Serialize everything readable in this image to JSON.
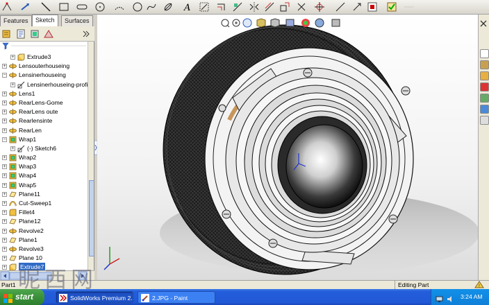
{
  "tabs": [
    {
      "label": "Features",
      "active": false
    },
    {
      "label": "Sketch",
      "active": true
    },
    {
      "label": "Surfaces",
      "active": false
    }
  ],
  "tree": {
    "items": [
      {
        "label": "Extrude3",
        "icon": "extrude-icon",
        "indent": 1
      },
      {
        "label": "Lensouterhouseing",
        "icon": "revolve-icon",
        "indent": 0
      },
      {
        "label": "Lensinerhouseing",
        "icon": "revolve-icon",
        "indent": 0,
        "expanded": true
      },
      {
        "label": "Lensinerhouseing-profil",
        "icon": "sketch-icon",
        "indent": 1
      },
      {
        "label": "Lens1",
        "icon": "revolve-icon",
        "indent": 0
      },
      {
        "label": "RearLens-Gome",
        "icon": "revolve-icon",
        "indent": 0
      },
      {
        "label": "RearLens oute",
        "icon": "revolve-icon",
        "indent": 0
      },
      {
        "label": "Rearlensinte",
        "icon": "revolve-icon",
        "indent": 0
      },
      {
        "label": "RearLen",
        "icon": "revolve-icon",
        "indent": 0
      },
      {
        "label": "Wrap1",
        "icon": "wrap-icon",
        "indent": 0,
        "expanded": true
      },
      {
        "label": "(-) Sketch6",
        "icon": "sketch-icon",
        "indent": 1
      },
      {
        "label": "Wrap2",
        "icon": "wrap-icon",
        "indent": 0
      },
      {
        "label": "Wrap3",
        "icon": "wrap-icon",
        "indent": 0
      },
      {
        "label": "Wrap4",
        "icon": "wrap-icon",
        "indent": 0
      },
      {
        "label": "Wrap5",
        "icon": "wrap-icon",
        "indent": 0
      },
      {
        "label": "Plane11",
        "icon": "plane-icon",
        "indent": 0
      },
      {
        "label": "Cut-Sweep1",
        "icon": "sweep-icon",
        "indent": 0
      },
      {
        "label": "Fillet4",
        "icon": "fillet-icon",
        "indent": 0
      },
      {
        "label": "Plane12",
        "icon": "plane-icon",
        "indent": 0
      },
      {
        "label": "Revolve2",
        "icon": "revolve-icon",
        "indent": 0
      },
      {
        "label": "Plane1",
        "icon": "plane-icon",
        "indent": 0
      },
      {
        "label": "Revolve3",
        "icon": "revolve-icon",
        "indent": 0
      },
      {
        "label": "Plane 10",
        "icon": "plane-icon",
        "indent": 0
      },
      {
        "label": "Extrude7",
        "icon": "extrude-icon",
        "indent": 0,
        "selected": true
      }
    ]
  },
  "status": {
    "part": "Part1",
    "mode": "Editing Part"
  },
  "taskbar": {
    "start_label": "start",
    "tasks": [
      {
        "label": "SolidWorks Premium 2...",
        "icon": "solidworks-icon",
        "active": true
      },
      {
        "label": "2.JPG - Paint",
        "icon": "paint-icon",
        "active": false
      }
    ],
    "clock": "3:24 AM"
  },
  "watermark": "昵西网",
  "colors": {
    "selection": "#316ac5",
    "taskbar": "#245edb",
    "start": "#3a913a",
    "viewport_bg": "#f2f2f2"
  }
}
